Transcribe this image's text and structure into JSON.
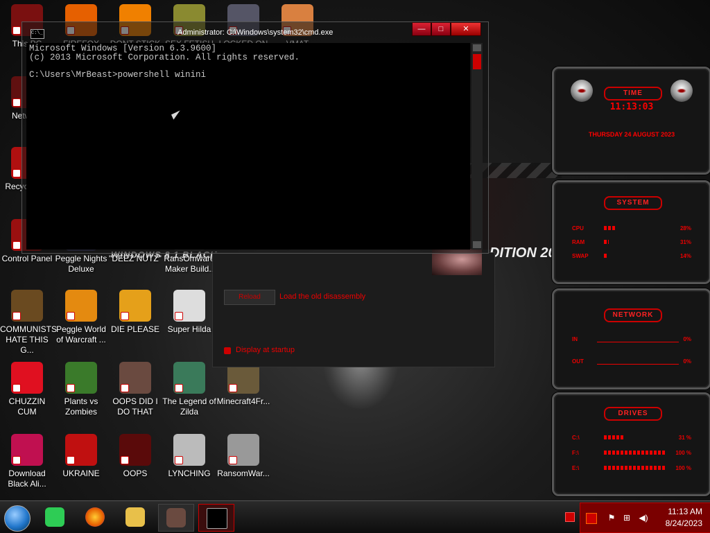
{
  "desktop": {
    "wallpaper_text": {
      "brand": "WINDOWS 8.1 BLACK",
      "edition": "DITION 20"
    },
    "icons": [
      {
        "id": "this-pc",
        "label": "This PC",
        "color": "#7a1010"
      },
      {
        "id": "firefox",
        "label": "FIREFOX",
        "color": "#e66000"
      },
      {
        "id": "vlc",
        "label": "DONT STICK",
        "color": "#f08000"
      },
      {
        "id": "sex-fetish",
        "label": "SEX FETISH",
        "color": "#8a8a30"
      },
      {
        "id": "locked-on",
        "label": "LOCKED ON",
        "color": "#556"
      },
      {
        "id": "vmat",
        "label": "VMAT",
        "color": "#d98040"
      },
      {
        "id": "network",
        "label": "Network",
        "color": "#601010"
      },
      {
        "id": "recycle-bin",
        "label": "Recycle Bin",
        "color": "#b01010"
      },
      {
        "id": "control-panel",
        "label": "Control Panel",
        "color": "#9a1010"
      },
      {
        "id": "peggle-nights",
        "label": "Peggle Nights Deluxe",
        "color": "#335"
      },
      {
        "id": "deez-nutz",
        "label": "\"DEEZ NUTZ\"",
        "color": "#222"
      },
      {
        "id": "ransomware-maker",
        "label": "RansOmware Maker Build..",
        "color": "#333"
      },
      {
        "id": "communists",
        "label": "COMMUNISTS HATE THIS G...",
        "color": "#6a4a20"
      },
      {
        "id": "peggle-world",
        "label": "Peggle World of Warcraft ...",
        "color": "#e48a10"
      },
      {
        "id": "die-please",
        "label": "DIE PLEASE",
        "color": "#e5a01a"
      },
      {
        "id": "super-hilda",
        "label": "Super Hilda",
        "color": "#ddd"
      },
      {
        "id": "chuzzin-cum",
        "label": "CHUZZIN CUM",
        "color": "#e01020"
      },
      {
        "id": "plants-vs-zombies",
        "label": "Plants vs Zombies",
        "color": "#3a7a2a"
      },
      {
        "id": "oops-did-i",
        "label": "OOPS DID I DO THAT",
        "color": "#6a4a40"
      },
      {
        "id": "legend-of-zilda",
        "label": "The Legend of Zilda",
        "color": "#3a7a5a"
      },
      {
        "id": "minecraft",
        "label": "Minecraft4Fr...",
        "color": "#6a5a3a"
      },
      {
        "id": "download-black-ali",
        "label": "Download Black Ali...",
        "color": "#c01050"
      },
      {
        "id": "ukraine",
        "label": "UKRAINE",
        "color": "#c01010"
      },
      {
        "id": "oops",
        "label": "OOPS",
        "color": "#5a0a0a"
      },
      {
        "id": "lynching",
        "label": "LYNCHING",
        "color": "#bbb"
      },
      {
        "id": "ransomware",
        "label": "RansomWar...",
        "color": "#999"
      }
    ]
  },
  "dialog": {
    "button_label": "Reload",
    "link_text": "Load the old disassembly",
    "checkbox_label": "Display at startup"
  },
  "cmd": {
    "title": "Administrator: C:\\Windows\\system32\\cmd.exe",
    "icon_text": "C:\\_",
    "lines": [
      "Microsoft Windows [Version 6.3.9600]",
      "(c) 2013 Microsoft Corporation. All rights reserved.",
      "",
      "C:\\Users\\MrBeast>powershell winini"
    ],
    "buttons": {
      "minimize": "—",
      "maximize": "□",
      "close": "✕"
    }
  },
  "gadgets": {
    "time": {
      "header": "TIME",
      "time": "11:13:03",
      "date": "THURSDAY 24 AUGUST 2023"
    },
    "system": {
      "header": "SYSTEM",
      "rows": [
        {
          "label": "CPU",
          "value": "28%",
          "level": 0.18
        },
        {
          "label": "RAM",
          "value": "31%",
          "level": 0.08
        },
        {
          "label": "SWAP",
          "value": "14%",
          "level": 0.06
        }
      ]
    },
    "network": {
      "header": "NETWORK",
      "rows": [
        {
          "label": "IN",
          "value": "0%"
        },
        {
          "label": "OUT",
          "value": "0%"
        }
      ]
    },
    "drives": {
      "header": "DRIVES",
      "rows": [
        {
          "label": "C:\\",
          "value": "31 %",
          "level": 0.31
        },
        {
          "label": "F:\\",
          "value": "100 %",
          "level": 1.0
        },
        {
          "label": "E:\\",
          "value": "100 %",
          "level": 1.0
        }
      ]
    }
  },
  "taskbar": {
    "items": [
      {
        "id": "start",
        "icon": "start-orb-icon"
      },
      {
        "id": "feedback-hub",
        "icon": "feedback-icon",
        "color": "#2ecc55"
      },
      {
        "id": "firefox",
        "icon": "firefox-icon",
        "color": "#e66000"
      },
      {
        "id": "file-explorer",
        "icon": "folder-icon",
        "color": "#e8c04a"
      },
      {
        "id": "photo-app",
        "icon": "portrait-icon",
        "color": "#6a4a40"
      },
      {
        "id": "cmd",
        "icon": "terminal-icon",
        "color": "#000"
      }
    ],
    "clock": {
      "time": "11:13 AM",
      "date": "8/24/2023"
    },
    "tray_icons": [
      "flag-icon",
      "network-icon",
      "volume-icon"
    ]
  }
}
